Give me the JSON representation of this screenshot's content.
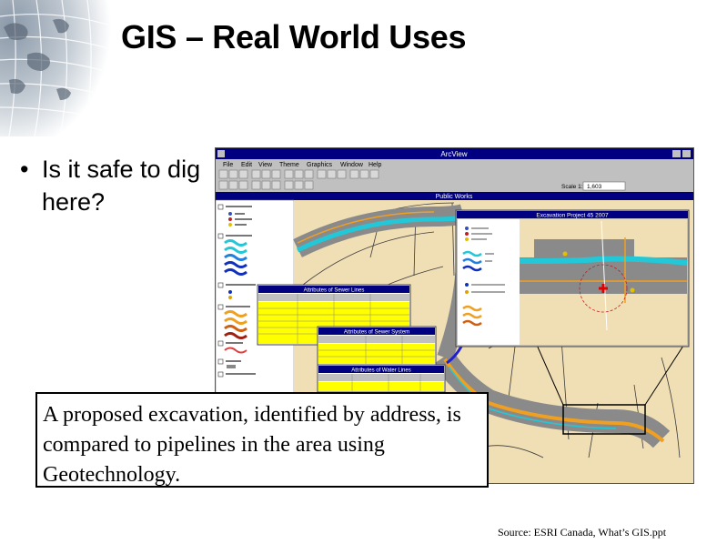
{
  "slide": {
    "title": "GIS – Real World Uses",
    "bullet": "Is it safe to dig here?",
    "callout": "A proposed excavation, identified by address, is compared to pipelines in the area using Geotechnology.",
    "source": "Source: ESRI Canada, What’s GIS.ppt"
  },
  "screenshot": {
    "app_title": "ArcView",
    "menu": [
      "File",
      "Edit",
      "View",
      "Theme",
      "Graphics",
      "Window",
      "Help"
    ],
    "scale_label": "Scale 1:",
    "scale_value": "1,603",
    "map_window_title": "Public Works",
    "inset_window_title": "Excavation Project 45 2007",
    "table_sewer_lines_title": "Attributes of Sewer Lines",
    "table_sewer_system_title": "Attributes of Sewer System",
    "table_water_lines_title": "Attributes of Water Lines"
  },
  "colors": {
    "title_bar": "#000080",
    "map_background": "#f0deb4",
    "road_fill": "#8a8a8a",
    "water_line": "#23c8d8",
    "sewer_line": "#f0a020",
    "excavation_marker": "#e00000",
    "table_highlight": "#ffff00"
  }
}
